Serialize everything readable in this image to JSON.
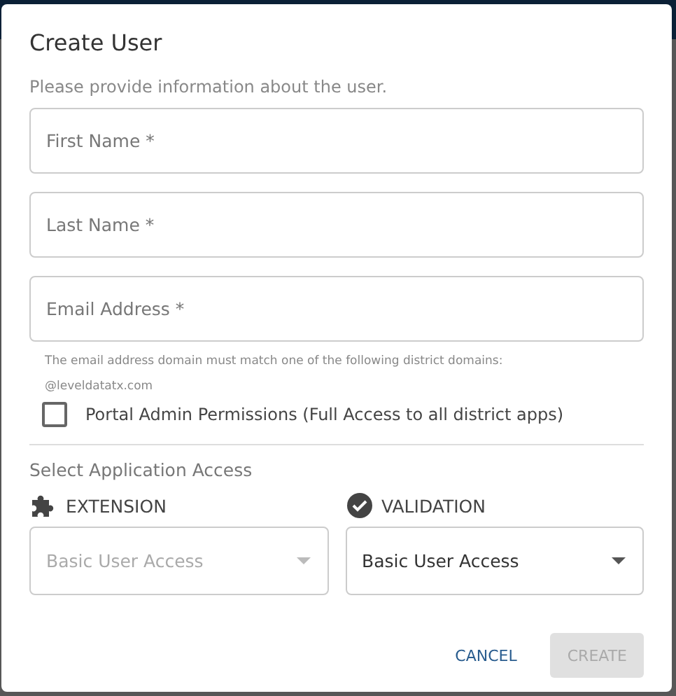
{
  "dialog": {
    "title": "Create User",
    "intro": "Please provide information about the user."
  },
  "fields": [
    {
      "placeholder": "First Name *"
    },
    {
      "placeholder": "Last Name *"
    },
    {
      "placeholder": "Email Address *"
    }
  ],
  "email_hint": [
    "The email address domain must match one of the following district domains:",
    "@leveldatatx.com"
  ],
  "admin_checkbox": {
    "label": "Portal Admin Permissions (Full Access to all district apps)",
    "checked": false
  },
  "access": {
    "heading": "Select Application Access",
    "apps": [
      {
        "name": "EXTENSION",
        "kind": "puzzle",
        "value": "Basic User Access",
        "disabled": true
      },
      {
        "name": "VALIDATION",
        "kind": "check",
        "value": "Basic User Access",
        "disabled": false
      }
    ]
  },
  "buttons": [
    {
      "label": "CANCEL",
      "disabled": false
    },
    {
      "label": "CREATE",
      "disabled": true
    }
  ]
}
